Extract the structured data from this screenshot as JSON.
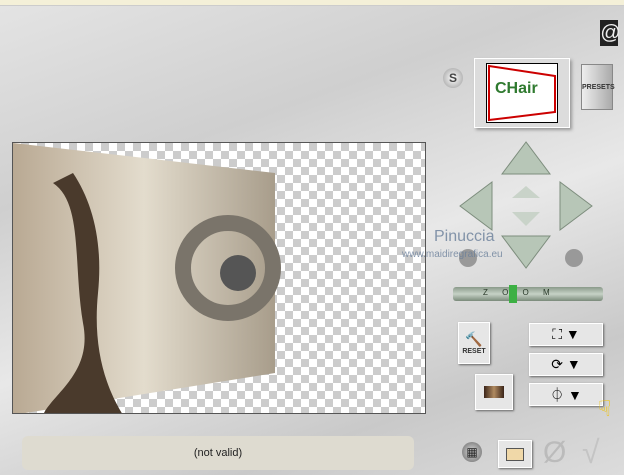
{
  "status": {
    "text": "(not valid)"
  },
  "presets": {
    "label": "PRESETS"
  },
  "reset": {
    "label": "RESET"
  },
  "zoom": {
    "label": "Z O O M",
    "level": 0.35
  },
  "thumbnail": {
    "text": "CHair"
  },
  "watermark": {
    "name": "Pinuccia",
    "url": "www.maidiregrafica.eu"
  },
  "s_button": {
    "label": "S"
  },
  "colors": {
    "accent": "#2f7a2f",
    "status_bg": "#dedbd0"
  }
}
